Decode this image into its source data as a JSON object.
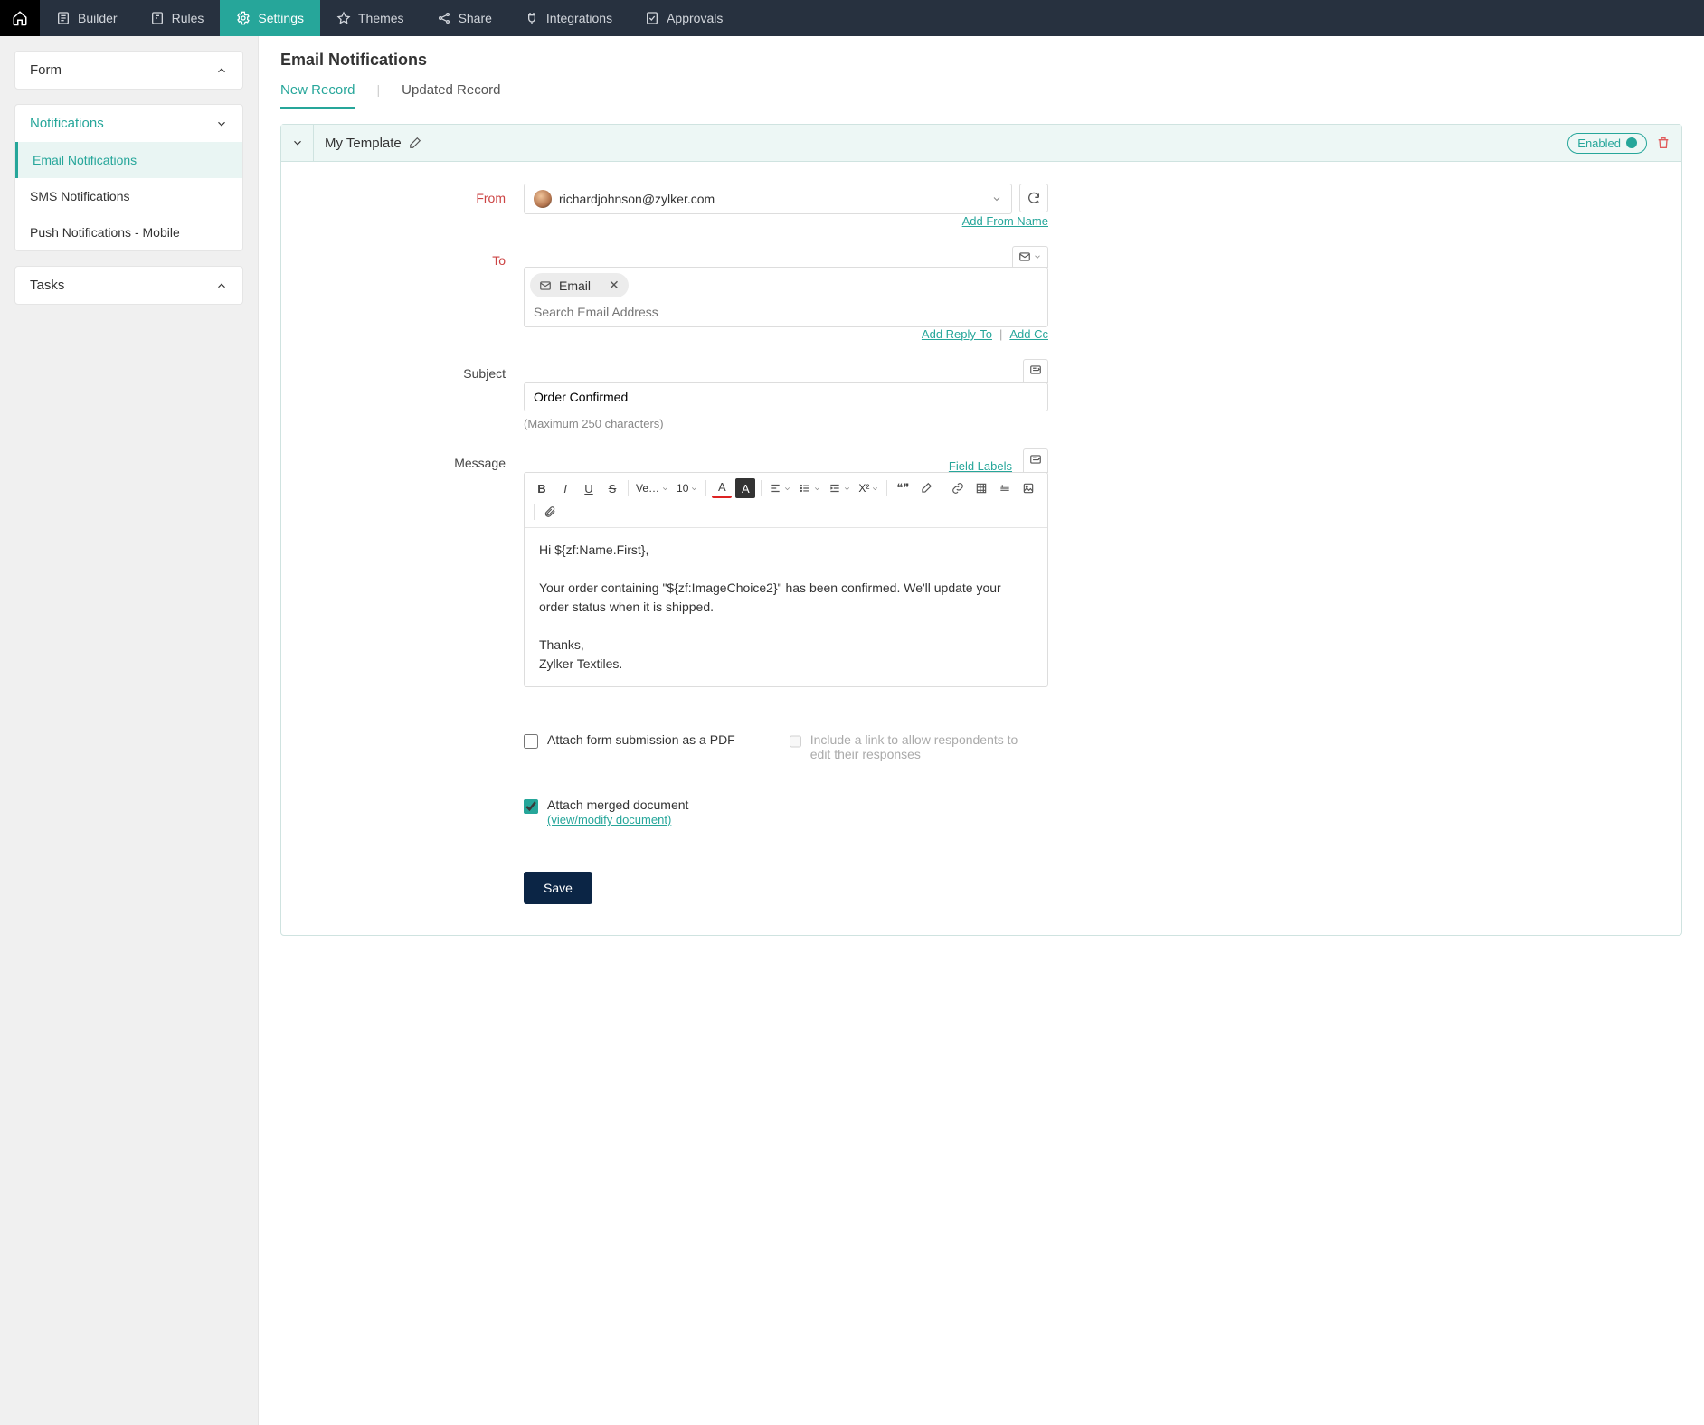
{
  "nav": {
    "items": [
      "Builder",
      "Rules",
      "Settings",
      "Themes",
      "Share",
      "Integrations",
      "Approvals"
    ],
    "active": "Settings"
  },
  "sidebar": {
    "sections": {
      "form": "Form",
      "notifications": "Notifications",
      "tasks": "Tasks"
    },
    "notif_items": [
      "Email Notifications",
      "SMS Notifications",
      "Push Notifications - Mobile"
    ],
    "active_notif": "Email Notifications"
  },
  "page": {
    "title": "Email Notifications",
    "tabs": [
      "New Record",
      "Updated Record"
    ],
    "active_tab": "New Record"
  },
  "template": {
    "name": "My Template",
    "enabled_label": "Enabled"
  },
  "form": {
    "from": {
      "label": "From",
      "value": "richardjohnson@zylker.com",
      "add_from_name": "Add From Name"
    },
    "to": {
      "label": "To",
      "chip": "Email",
      "placeholder": "Search Email Address",
      "add_reply_to": "Add Reply-To",
      "add_cc": "Add Cc"
    },
    "subject": {
      "label": "Subject",
      "value": "Order Confirmed",
      "hint": "(Maximum 250 characters)"
    },
    "message": {
      "label": "Message",
      "field_labels": "Field Labels",
      "body": "Hi ${zf:Name.First},\n\nYour order containing \"${zf:ImageChoice2}\" has been confirmed. We'll update your order status when it is shipped.\n\nThanks,\nZylker Textiles."
    },
    "toolbar": {
      "font": "Ve…",
      "size": "10"
    },
    "options": {
      "attach_pdf": "Attach form submission as a PDF",
      "include_link": "Include a link to allow respondents to edit their responses",
      "attach_merged": "Attach merged document",
      "view_modify": "(view/modify document)"
    },
    "save": "Save"
  }
}
